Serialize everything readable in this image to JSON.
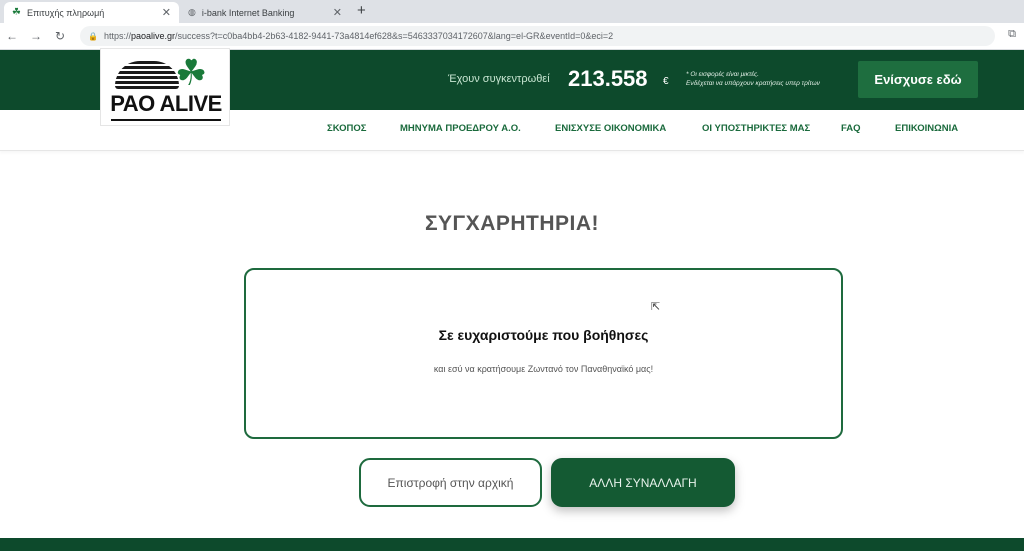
{
  "browser": {
    "tabs": [
      {
        "title": "Επιτυχής πληρωμή",
        "active": true
      },
      {
        "title": "i-bank Internet Banking",
        "active": false
      }
    ],
    "new_tab": "+",
    "url_prefix": "https://",
    "url_domain": "paoalive.gr",
    "url_rest": "/success?t=c0ba4bb4-2b63-4182-9441-73a4814ef628&s=5463337034172607&lang=el-GR&eventId=0&eci=2"
  },
  "site": {
    "logo_text": "PAO ALIVE",
    "raised_label": "Έχουν συγκεντρωθεί",
    "raised_amount": "213.558",
    "currency": "€",
    "note_line1": "* Οι εισφορές είναι μικτές.",
    "note_line2": "Ενδέχεται να υπάρχουν κρατήσεις υπερ τρίτων",
    "support_button": "Ενίσχυσε εδώ",
    "nav": [
      "ΣΚΟΠΟΣ",
      "ΜΗΝΥΜΑ ΠΡΟΕΔΡΟΥ Α.Ο.",
      "ΕΝΙΣΧΥΣΕ ΟΙΚΟΝΟΜΙΚΑ",
      "ΟΙ ΥΠΟΣΤΗΡΙΚΤΕΣ ΜΑΣ",
      "FAQ",
      "ΕΠΙΚΟΙΝΩΝΙΑ"
    ]
  },
  "main": {
    "title": "ΣΥΓΧΑΡΗΤΗΡΙΑ!",
    "thanks": "Σε ευχαριστούμε που βοήθησες",
    "subtext": "και εσύ να κρατήσουμε Ζωντανό τον Παναθηναϊκό μας!",
    "home_button": "Επιστροφή στην αρχική",
    "transaction_button": "ΑΛΛΗ ΣΥΝΑΛΛΑΓΗ"
  },
  "colors": {
    "brand_dark_green": "#0d4a2c",
    "brand_green": "#1e6a3e"
  }
}
